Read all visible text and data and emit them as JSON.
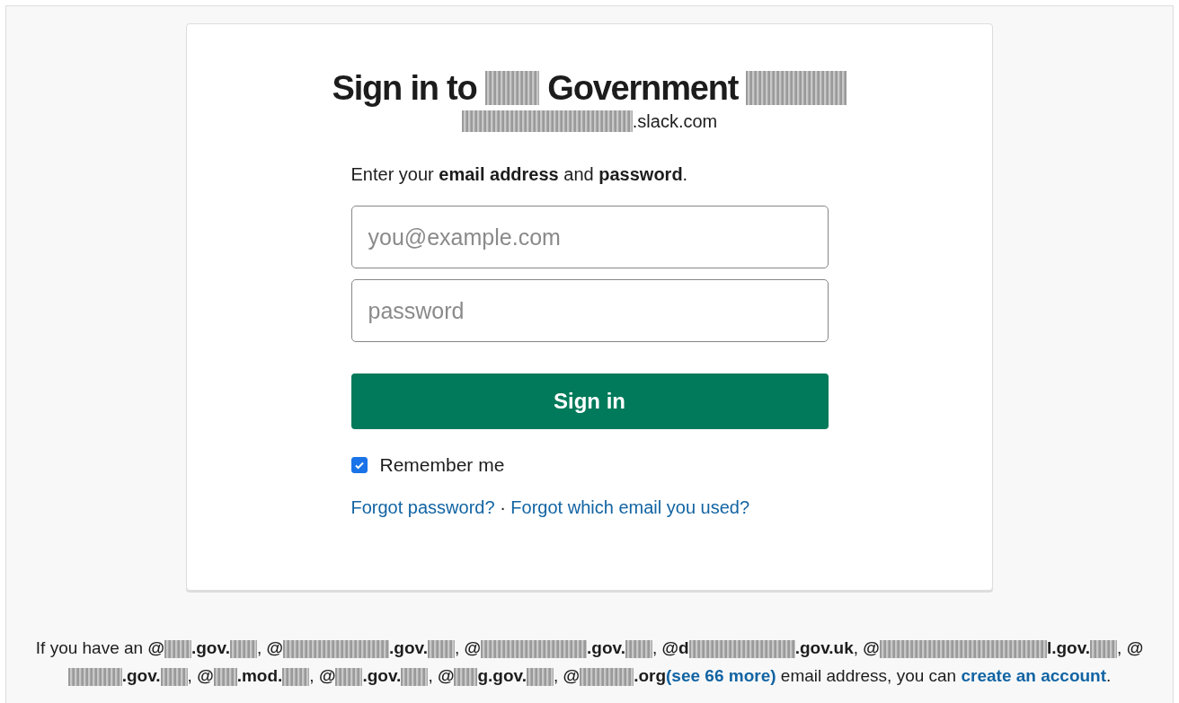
{
  "card": {
    "title": [
      {
        "kind": "text",
        "text": "Sign in to "
      },
      {
        "kind": "redacted"
      },
      {
        "kind": "text",
        "text": " Government "
      },
      {
        "kind": "redacted"
      }
    ],
    "subdomain": [
      {
        "kind": "redacted"
      },
      {
        "kind": "text",
        "text": ".slack.com"
      }
    ],
    "instruction": [
      {
        "kind": "text",
        "text": "Enter your "
      },
      {
        "kind": "bold",
        "text": "email address"
      },
      {
        "kind": "text",
        "text": " and "
      },
      {
        "kind": "bold",
        "text": "password"
      },
      {
        "kind": "text",
        "text": "."
      }
    ],
    "email_field": {
      "placeholder": "you@example.com"
    },
    "password_field": {
      "placeholder": "password"
    },
    "sign_in_button": "Sign in",
    "remember_me": {
      "label": "Remember me",
      "checked": true
    },
    "links": [
      {
        "kind": "link",
        "text": "Forgot password?"
      },
      {
        "kind": "text",
        "text": " · "
      },
      {
        "kind": "link",
        "text": "Forgot which email you used?"
      }
    ]
  },
  "footer": [
    {
      "kind": "text",
      "text": "If you have an "
    },
    {
      "kind": "bold",
      "text": "@"
    },
    {
      "kind": "redacted"
    },
    {
      "kind": "bold",
      "text": ".gov."
    },
    {
      "kind": "redacted"
    },
    {
      "kind": "text",
      "text": ", "
    },
    {
      "kind": "bold",
      "text": "@"
    },
    {
      "kind": "redacted"
    },
    {
      "kind": "bold",
      "text": ".gov."
    },
    {
      "kind": "redacted"
    },
    {
      "kind": "text",
      "text": ", "
    },
    {
      "kind": "bold",
      "text": "@"
    },
    {
      "kind": "redacted"
    },
    {
      "kind": "bold",
      "text": ".gov."
    },
    {
      "kind": "redacted"
    },
    {
      "kind": "text",
      "text": ", "
    },
    {
      "kind": "bold",
      "text": "@d"
    },
    {
      "kind": "redacted"
    },
    {
      "kind": "bold",
      "text": ".gov.uk"
    },
    {
      "kind": "text",
      "text": ", "
    },
    {
      "kind": "bold",
      "text": "@"
    },
    {
      "kind": "redacted"
    },
    {
      "kind": "bold",
      "text": "l.gov."
    },
    {
      "kind": "redacted"
    },
    {
      "kind": "text",
      "text": ", "
    },
    {
      "kind": "bold",
      "text": "@"
    },
    {
      "kind": "redacted"
    },
    {
      "kind": "bold",
      "text": ".gov."
    },
    {
      "kind": "redacted"
    },
    {
      "kind": "text",
      "text": ", "
    },
    {
      "kind": "bold",
      "text": "@"
    },
    {
      "kind": "redacted"
    },
    {
      "kind": "bold",
      "text": ".mod."
    },
    {
      "kind": "redacted"
    },
    {
      "kind": "text",
      "text": ", "
    },
    {
      "kind": "bold",
      "text": "@"
    },
    {
      "kind": "redacted"
    },
    {
      "kind": "bold",
      "text": ".gov."
    },
    {
      "kind": "redacted"
    },
    {
      "kind": "text",
      "text": ", "
    },
    {
      "kind": "bold",
      "text": "@"
    },
    {
      "kind": "redacted"
    },
    {
      "kind": "bold",
      "text": "g.gov."
    },
    {
      "kind": "redacted"
    },
    {
      "kind": "text",
      "text": ", "
    },
    {
      "kind": "bold",
      "text": "@"
    },
    {
      "kind": "redacted"
    },
    {
      "kind": "bold",
      "text": ".org"
    },
    {
      "kind": "link",
      "text": "(see 66 more)"
    },
    {
      "kind": "text",
      "text": " email address, you can "
    },
    {
      "kind": "link",
      "text": "create an account"
    },
    {
      "kind": "text",
      "text": "."
    }
  ]
}
